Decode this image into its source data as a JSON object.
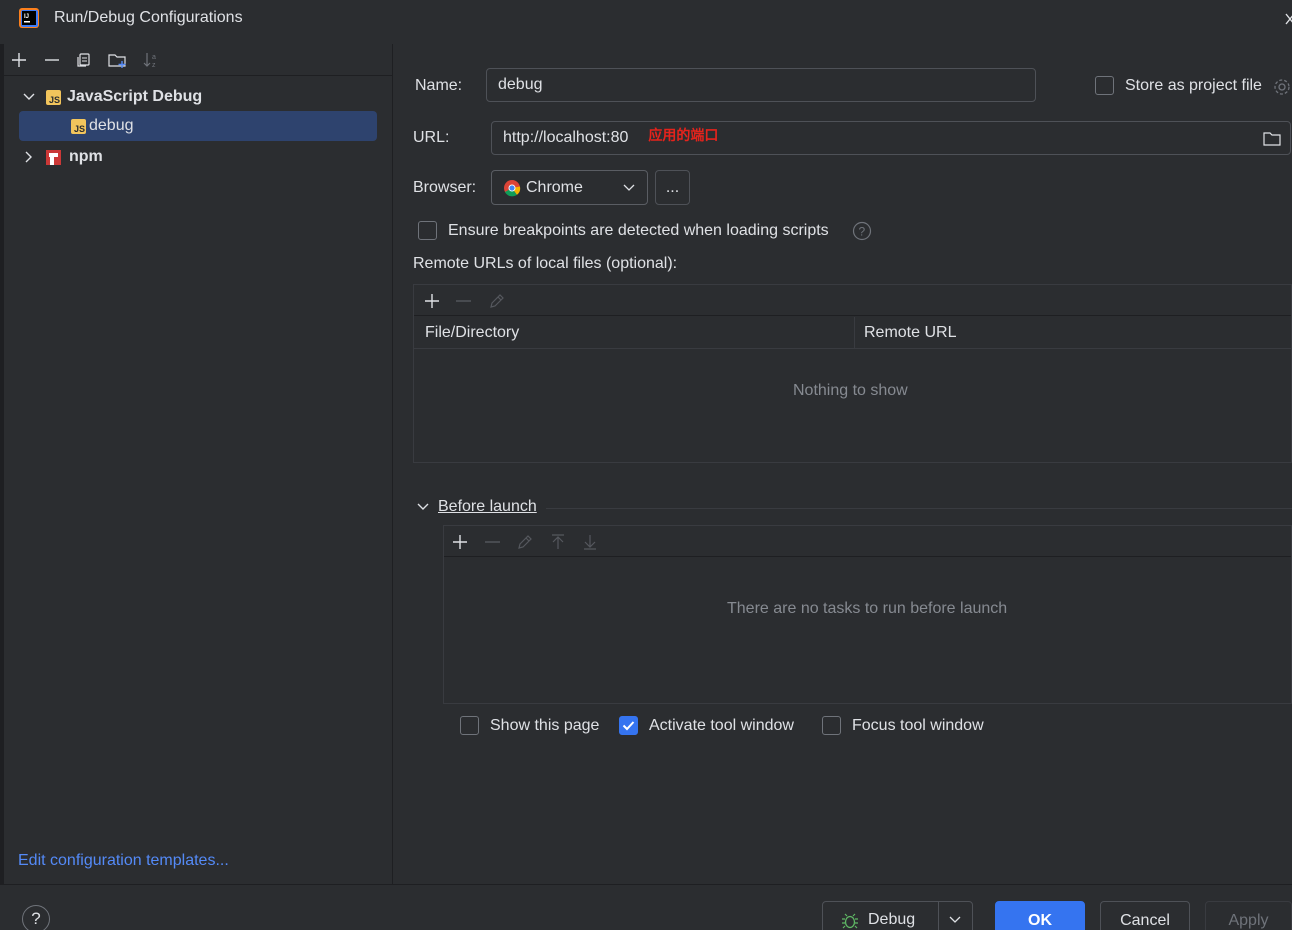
{
  "window": {
    "title": "Run/Debug Configurations"
  },
  "tree_toolbar": {
    "buttons": [
      "add-icon",
      "remove-icon",
      "copy-icon",
      "new-folder-icon",
      "sort-icon"
    ]
  },
  "tree": {
    "groups": [
      {
        "label": "JavaScript Debug",
        "expanded": true,
        "icon": "javascript-icon",
        "children": [
          {
            "label": "debug",
            "icon": "javascript-icon",
            "selected": true
          }
        ]
      },
      {
        "label": "npm",
        "expanded": false,
        "icon": "npm-icon",
        "children": []
      }
    ]
  },
  "edit_templates_link": "Edit configuration templates...",
  "form": {
    "name_label": "Name:",
    "name_value": "debug",
    "store_label": "Store as project file",
    "url_label": "URL:",
    "url_value": "http://localhost:80",
    "url_annotation": "应用的端口",
    "browser_label": "Browser:",
    "browser_value": "Chrome",
    "browser_more": "...",
    "ensure_breakpoints_label": "Ensure breakpoints are detected when loading scripts",
    "remote_urls_label": "Remote URLs of local files (optional):",
    "remote_table": {
      "columns": [
        "File/Directory",
        "Remote URL"
      ],
      "empty_text": "Nothing to show"
    },
    "before_launch_label": "Before launch",
    "before_launch_empty": "There are no tasks to run before launch",
    "show_page_label": "Show this page",
    "activate_tool_label": "Activate tool window",
    "focus_tool_label": "Focus tool window",
    "checkbox_states": {
      "store": false,
      "ensure": false,
      "show_page": false,
      "activate": true,
      "focus": false
    }
  },
  "footer": {
    "debug_label": "Debug",
    "ok_label": "OK",
    "cancel_label": "Cancel",
    "apply_label": "Apply",
    "help_label": "?"
  },
  "colors": {
    "accent": "#3574f0",
    "link": "#548af7",
    "annotation": "#e5231c",
    "selection": "#2e436e"
  }
}
